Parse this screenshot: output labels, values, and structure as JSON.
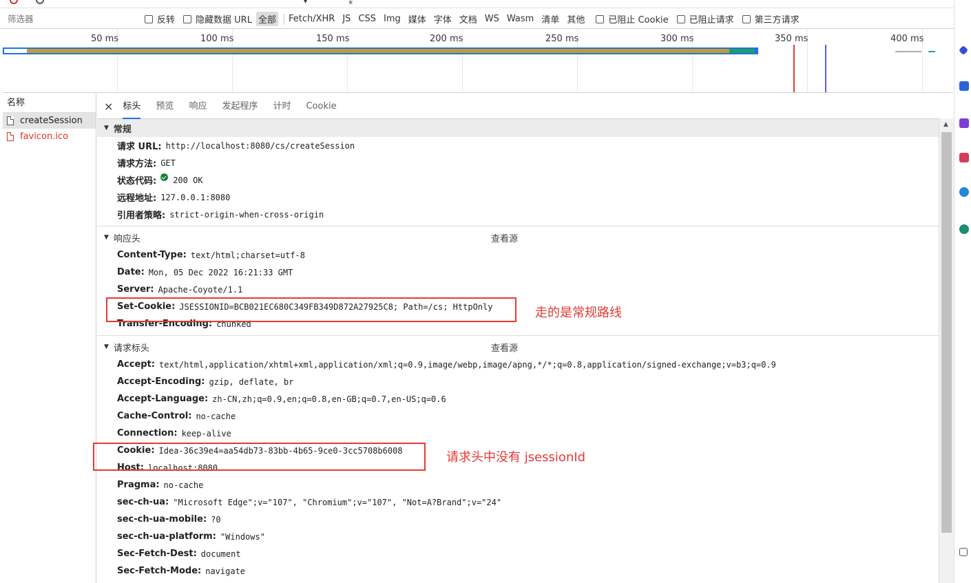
{
  "filter_bar": {
    "placeholder": "筛选器",
    "invert_label": "反转",
    "hide_data_url_label": "隐藏数据 URL",
    "types": [
      "全部",
      "Fetch/XHR",
      "JS",
      "CSS",
      "Img",
      "媒体",
      "字体",
      "文档",
      "WS",
      "Wasm",
      "清单",
      "其他"
    ],
    "active_type": "全部",
    "blocked_cookies_label": "已阻止 Cookie",
    "blocked_requests_label": "已阻止请求",
    "third_party_label": "第三方请求"
  },
  "timeline": {
    "ticks": [
      "50 ms",
      "100 ms",
      "150 ms",
      "200 ms",
      "250 ms",
      "300 ms",
      "350 ms",
      "400 ms"
    ]
  },
  "request_list": {
    "header": "名称",
    "items": [
      {
        "name": "createSession",
        "status": "selected"
      },
      {
        "name": "favicon.ico",
        "status": "error"
      }
    ]
  },
  "tabs": {
    "close_label": "×",
    "items": [
      "标头",
      "预览",
      "响应",
      "发起程序",
      "计时",
      "Cookie"
    ],
    "active": "标头"
  },
  "general": {
    "title": "常规",
    "rows": [
      {
        "key": "请求 URL:",
        "value": "http://localhost:8080/cs/createSession"
      },
      {
        "key": "请求方法:",
        "value": "GET"
      },
      {
        "key": "状态代码:",
        "value": "200 OK"
      },
      {
        "key": "远程地址:",
        "value": "127.0.0.1:8080"
      },
      {
        "key": "引用者策略:",
        "value": "strict-origin-when-cross-origin"
      }
    ]
  },
  "response_headers": {
    "title": "响应头",
    "view_source": "查看源",
    "rows": [
      {
        "key": "Content-Type:",
        "value": "text/html;charset=utf-8"
      },
      {
        "key": "Date:",
        "value": "Mon, 05 Dec 2022 16:21:33 GMT"
      },
      {
        "key": "Server:",
        "value": "Apache-Coyote/1.1"
      },
      {
        "key": "Set-Cookie:",
        "value": "JSESSIONID=BCB021EC680C349FB349D872A27925C8; Path=/cs; HttpOnly"
      },
      {
        "key": "Transfer-Encoding:",
        "value": "chunked"
      }
    ]
  },
  "request_headers": {
    "title": "请求标头",
    "view_source": "查看源",
    "rows": [
      {
        "key": "Accept:",
        "value": "text/html,application/xhtml+xml,application/xml;q=0.9,image/webp,image/apng,*/*;q=0.8,application/signed-exchange;v=b3;q=0.9"
      },
      {
        "key": "Accept-Encoding:",
        "value": "gzip, deflate, br"
      },
      {
        "key": "Accept-Language:",
        "value": "zh-CN,zh;q=0.9,en;q=0.8,en-GB;q=0.7,en-US;q=0.6"
      },
      {
        "key": "Cache-Control:",
        "value": "no-cache"
      },
      {
        "key": "Connection:",
        "value": "keep-alive"
      },
      {
        "key": "Cookie:",
        "value": "Idea-36c39e4=aa54db73-83bb-4b65-9ce0-3cc5708b6008"
      },
      {
        "key": "Host:",
        "value": "localhost:8080"
      },
      {
        "key": "Pragma:",
        "value": "no-cache"
      },
      {
        "key": "sec-ch-ua:",
        "value": "\"Microsoft Edge\";v=\"107\", \"Chromium\";v=\"107\", \"Not=A?Brand\";v=\"24\""
      },
      {
        "key": "sec-ch-ua-mobile:",
        "value": "?0"
      },
      {
        "key": "sec-ch-ua-platform:",
        "value": "\"Windows\""
      },
      {
        "key": "Sec-Fetch-Dest:",
        "value": "document"
      },
      {
        "key": "Sec-Fetch-Mode:",
        "value": "navigate"
      }
    ]
  },
  "annotations": {
    "set_cookie_note": "走的是常规路线",
    "cookie_note": "请求头中没有 jsessionId"
  },
  "colors": {
    "annotation_red": "#e53935",
    "accent_blue": "#1a73e8",
    "status_green": "#188038",
    "error_red": "#d93025"
  }
}
